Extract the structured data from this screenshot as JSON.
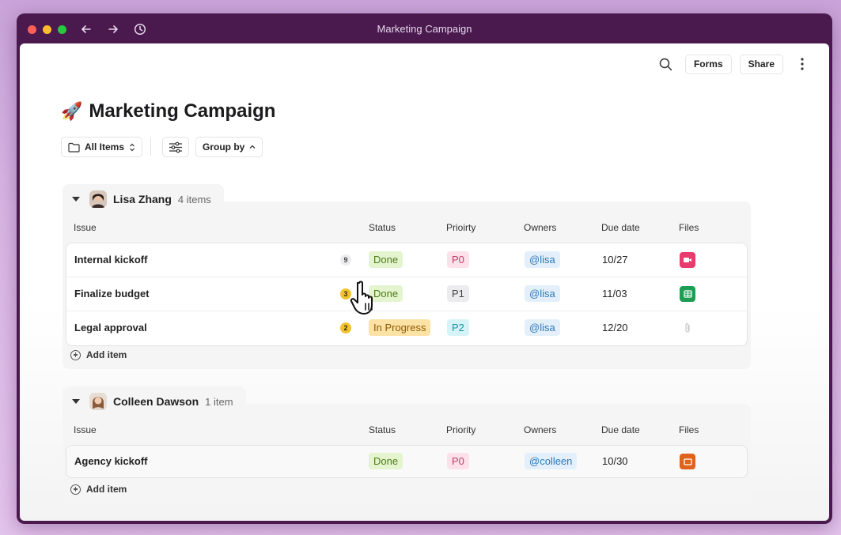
{
  "window": {
    "title": "Marketing Campaign"
  },
  "header": {
    "forms_label": "Forms",
    "share_label": "Share"
  },
  "page": {
    "emoji": "🚀",
    "title": "Marketing Campaign"
  },
  "toolbar": {
    "view_label": "All Items",
    "group_by_label": "Group by"
  },
  "groups": [
    {
      "name": "Lisa Zhang",
      "count": "4 items",
      "columns": {
        "issue": "Issue",
        "status": "Status",
        "priority": "Prioirty",
        "owners": "Owners",
        "due": "Due date",
        "files": "Files"
      },
      "rows": [
        {
          "issue": "Internal kickoff",
          "badge": "9",
          "status": "Done",
          "priority": "P0",
          "owner": "@lisa",
          "due": "10/27",
          "file_icon": "video-file-icon"
        },
        {
          "issue": "Finalize budget",
          "badge": "3",
          "status": "Done",
          "priority": "P1",
          "owner": "@lisa",
          "due": "11/03",
          "file_icon": "spreadsheet-file-icon"
        },
        {
          "issue": "Legal approval",
          "badge": "2",
          "status": "In Progress",
          "priority": "P2",
          "owner": "@lisa",
          "due": "12/20",
          "file_icon": "attachment-icon"
        }
      ],
      "add_label": "Add item"
    },
    {
      "name": "Colleen Dawson",
      "count": "1 item",
      "columns": {
        "issue": "Issue",
        "status": "Status",
        "priority": "Priority",
        "owners": "Owners",
        "due": "Due date",
        "files": "Files"
      },
      "rows": [
        {
          "issue": "Agency kickoff",
          "status": "Done",
          "priority": "P0",
          "owner": "@colleen",
          "due": "10/30",
          "file_icon": "slides-file-icon"
        }
      ],
      "add_label": "Add item"
    }
  ],
  "colors": {
    "done_bg": "#e4f4cf",
    "done_fg": "#4f7a1c",
    "progress_bg": "#fde2a6",
    "progress_fg": "#8a5a00",
    "p0_bg": "#fde1ea",
    "p0_fg": "#c73a6a",
    "p1_bg": "#ececee",
    "p1_fg": "#444444",
    "p2_bg": "#d6f3f8",
    "p2_fg": "#1f8fa6",
    "owner_bg": "#e3f0fb",
    "owner_fg": "#2f78b7"
  }
}
